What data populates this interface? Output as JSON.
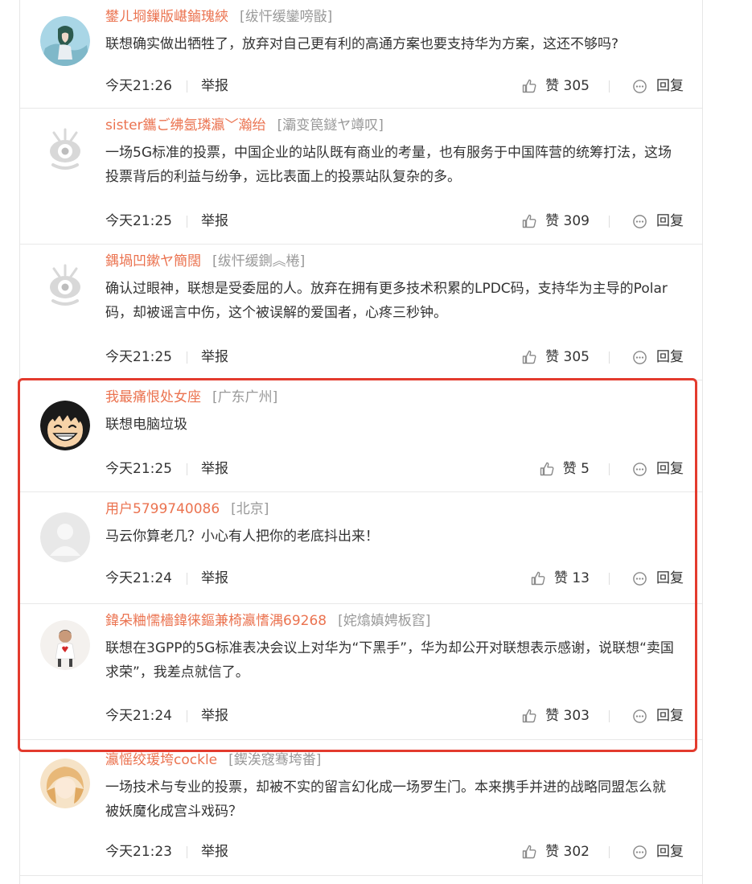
{
  "comments": [
    {
      "username": "鐢ㄦ埛鏁版嵁鏀瑰綊",
      "location": "[绂忓缓鑾嗙敯]",
      "text": "联想确实做出牺牲了，放弃对自己更有利的高通方案也要支持华为方案，这还不够吗?",
      "time": "今天21:26",
      "report": "举报",
      "likes": "赞 305",
      "reply": "回复",
      "avatar": "anime-avatar"
    },
    {
      "username": "sister鑴ご绋氬璘瀛﹀瀚绐",
      "location": "[灞变笢鐩ヤ竴叹]",
      "text": "一场5G标准的投票，中国企业的站队既有商业的考量，也有服务于中国阵营的统筹打法，这场投票背后的利益与纷争，远比表面上的投票站队复杂的多。",
      "time": "今天21:25",
      "report": "举报",
      "likes": "赞 309",
      "reply": "回复",
      "avatar": "default-weibo-avatar"
    },
    {
      "username": "鍝堝凹鏉ヤ簡闊",
      "location": "[绂忓缓鍘︽棬]",
      "text": "确认过眼神，联想是受委屈的人。放弃在拥有更多技术积累的LPDC码，支持华为主导的Polar码，却被谣言中伤，这个被误解的爱国者，心疼三秒钟。",
      "time": "今天21:25",
      "report": "举报",
      "likes": "赞 305",
      "reply": "回复",
      "avatar": "default-weibo-avatar"
    },
    {
      "username": "我最痛恨处女座",
      "location": "[广东广州]",
      "text": "联想电脑垃圾",
      "time": "今天21:25",
      "report": "举报",
      "likes": "赞 5",
      "reply": "回复",
      "avatar": "cartoon-boy-avatar"
    },
    {
      "username": "用户5799740086",
      "location": "[北京]",
      "text": "马云你算老几？小心有人把你的老底抖出来！",
      "time": "今天21:24",
      "report": "举报",
      "likes": "赞 13",
      "reply": "回复",
      "avatar": "blank-avatar"
    },
    {
      "username": "鍏朵粬懦檣鍏徕鏂兼椅瀛愭湡69268",
      "location": "[姹熻嫃娉板窞]",
      "text": "联想在3GPP的5G标准表决会议上对华为“下黑手”，华为却公开对联想表示感谢，说联想“卖国求荣”，我差点就信了。",
      "time": "今天21:24",
      "report": "举报",
      "likes": "赞 303",
      "reply": "回复",
      "avatar": "photo-avatar"
    },
    {
      "username": "瀛愮绞瑗垮cockle",
      "location": "[鍥涘窛骞垮畨]",
      "text": "一场技术与专业的投票，却被不实的留言幻化成一场罗生门。本来携手并进的战略同盟怎么就被妖魔化成宫斗戏码？",
      "time": "今天21:23",
      "report": "举报",
      "likes": "赞 302",
      "reply": "回复",
      "avatar": "anime-girl-avatar"
    }
  ],
  "colors": {
    "username": "#eb7350",
    "location": "#999999",
    "highlight_border": "#e33b2e"
  }
}
